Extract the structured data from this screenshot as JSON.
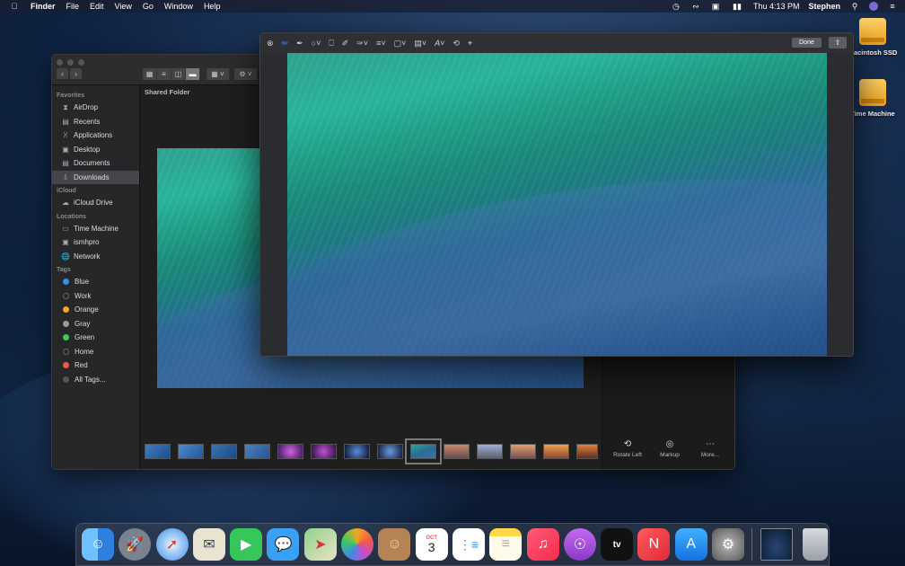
{
  "menubar": {
    "app": "Finder",
    "menus": [
      "File",
      "Edit",
      "View",
      "Go",
      "Window",
      "Help"
    ],
    "clock": "Thu 4:13 PM",
    "user": "Stephen"
  },
  "desktop": {
    "items": [
      {
        "label": "Macintosh SSD"
      },
      {
        "label": "Time Machine"
      }
    ]
  },
  "finder": {
    "path": "Shared Folder",
    "sidebar": {
      "sections": [
        {
          "title": "Favorites",
          "items": [
            {
              "label": "AirDrop",
              "icon": "airdrop-icon"
            },
            {
              "label": "Recents",
              "icon": "recents-icon"
            },
            {
              "label": "Applications",
              "icon": "applications-icon"
            },
            {
              "label": "Desktop",
              "icon": "desktop-icon"
            },
            {
              "label": "Documents",
              "icon": "documents-icon"
            },
            {
              "label": "Downloads",
              "icon": "downloads-icon",
              "selected": true
            }
          ]
        },
        {
          "title": "iCloud",
          "items": [
            {
              "label": "iCloud Drive",
              "icon": "cloud-icon"
            }
          ]
        },
        {
          "title": "Locations",
          "items": [
            {
              "label": "Time Machine",
              "icon": "disk-icon"
            },
            {
              "label": "ismhpro",
              "icon": "computer-icon"
            },
            {
              "label": "Network",
              "icon": "network-icon"
            }
          ]
        },
        {
          "title": "Tags",
          "items": [
            {
              "label": "Blue",
              "color": "#3a8ee6"
            },
            {
              "label": "Work",
              "color": "#2b2b2b"
            },
            {
              "label": "Orange",
              "color": "#f5a623"
            },
            {
              "label": "Gray",
              "color": "#9b9b9b"
            },
            {
              "label": "Green",
              "color": "#3fc95a"
            },
            {
              "label": "Home",
              "color": "#2b2b2b"
            },
            {
              "label": "Red",
              "color": "#f0574e"
            },
            {
              "label": "All Tags...",
              "color": "#555555"
            }
          ]
        }
      ]
    },
    "actions": {
      "rotate": "Rotate Left",
      "markup": "Markup",
      "more": "More..."
    }
  },
  "quicklook": {
    "done": "Done"
  },
  "dock": {
    "apps": [
      "Finder",
      "Launchpad",
      "Safari",
      "Mail",
      "FaceTime",
      "Messages",
      "Maps",
      "Photos",
      "Contacts",
      "Calendar",
      "Reminders",
      "Notes",
      "Music",
      "Podcasts",
      "TV",
      "News",
      "App Store",
      "System Preferences",
      "Downloads",
      "Trash"
    ],
    "calendar_month": "OCT",
    "calendar_day": "3",
    "tv_label": "tv"
  }
}
